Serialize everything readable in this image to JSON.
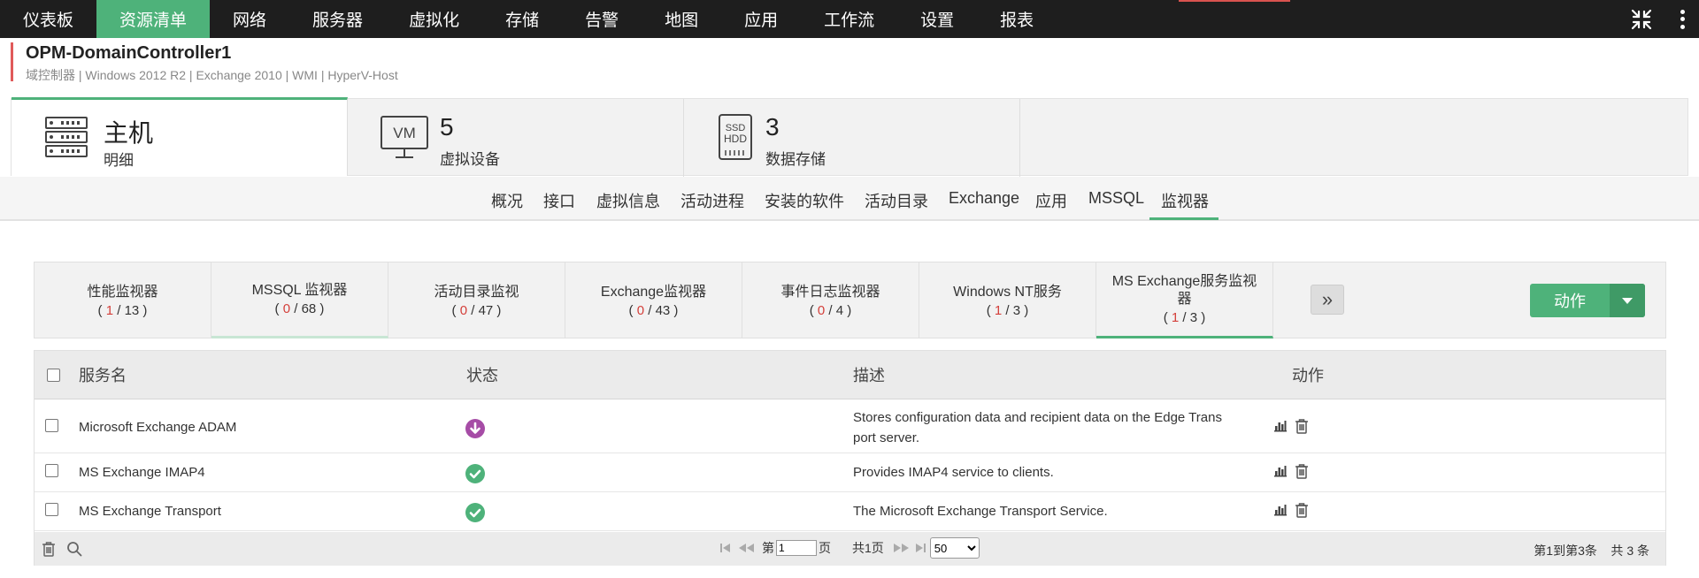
{
  "nav": {
    "items": [
      "仪表板",
      "资源清单",
      "网络",
      "服务器",
      "虚拟化",
      "存储",
      "告警",
      "地图",
      "应用",
      "工作流",
      "设置",
      "报表"
    ],
    "active_index": 1
  },
  "device": {
    "title": "OPM-DomainController1",
    "subtitle": "域控制器 | Windows 2012 R2  |  Exchange 2010  | WMI  | HyperV-Host"
  },
  "summary": {
    "host": {
      "big": "主机",
      "small": "明细"
    },
    "vm": {
      "icon_text": "VM",
      "big": "5",
      "small": "虚拟设备"
    },
    "store": {
      "icon_text_1": "SSD",
      "icon_text_2": "HDD",
      "big": "3",
      "small": "数据存储"
    }
  },
  "subtabs": [
    "概况",
    "接口",
    "虚拟信息",
    "活动进程",
    "安装的软件",
    "活动目录",
    "Exchange",
    "应用",
    "MSSQL",
    "监视器"
  ],
  "monitor_tabs": [
    {
      "label": "性能监视器",
      "count_red": "1",
      "count_total": "13"
    },
    {
      "label": "MSSQL 监视器",
      "count_red": "0",
      "count_total": "68"
    },
    {
      "label": "活动目录监视",
      "count_red": "0",
      "count_total": "47"
    },
    {
      "label": "Exchange监视器",
      "count_red": "0",
      "count_total": "43"
    },
    {
      "label": "事件日志监视器",
      "count_red": "0",
      "count_total": "4"
    },
    {
      "label": "Windows NT服务",
      "count_red": "1",
      "count_total": "3"
    },
    {
      "label": "MS Exchange服务监视器",
      "count_red": "1",
      "count_total": "3"
    }
  ],
  "more_label": "»",
  "action_label": "动作",
  "table": {
    "columns": [
      "服务名",
      "状态",
      "描述",
      "动作"
    ],
    "rows": [
      {
        "name": "Microsoft Exchange ADAM",
        "status": "down",
        "desc_1": "Stores configuration data and recipient data on the Edge Trans",
        "desc_2": "port server."
      },
      {
        "name": "MS Exchange IMAP4",
        "status": "up",
        "desc_1": "Provides IMAP4 service to clients.",
        "desc_2": ""
      },
      {
        "name": "MS Exchange Transport",
        "status": "up",
        "desc_1": "The Microsoft Exchange Transport Service.",
        "desc_2": ""
      }
    ]
  },
  "pager": {
    "page_prefix": "第",
    "page_value": "1",
    "page_suffix": "页",
    "total_pages": "共1页",
    "per_page": "50",
    "per_page_options": [
      "50"
    ],
    "status_text": "第1到第3条    共 3 条"
  },
  "colors": {
    "accent": "#4eb27a",
    "down": "#a64ca6",
    "alert": "#d43f3a"
  }
}
